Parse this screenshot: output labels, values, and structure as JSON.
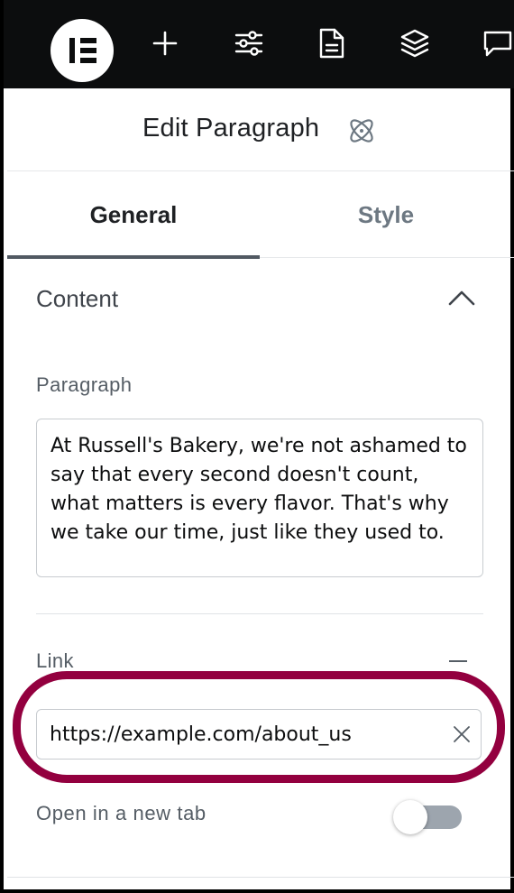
{
  "toolbar": {
    "logo": "elementor-logo",
    "icons": [
      "plus-icon",
      "sliders-icon",
      "page-icon",
      "layers-icon",
      "chat-icon"
    ]
  },
  "panel": {
    "title": "Edit Paragraph",
    "title_icon": "atom-icon"
  },
  "tabs": [
    {
      "label": "General",
      "active": true
    },
    {
      "label": "Style",
      "active": false
    }
  ],
  "content_section": {
    "title": "Content",
    "expanded": true,
    "paragraph": {
      "label": "Paragraph",
      "value": "At Russell's Bakery, we're not ashamed to say that every second doesn't count, what matters is every flavor. That's why we take our time, just like they used to."
    },
    "link": {
      "label": "Link",
      "value": "https://example.com/about_us"
    },
    "open_new_tab": {
      "label": "Open in a new tab",
      "enabled": false
    }
  },
  "colors": {
    "highlight": "#93003f",
    "toolbar_bg": "#0c0d0e",
    "toggle_off": "#9da5ae"
  }
}
